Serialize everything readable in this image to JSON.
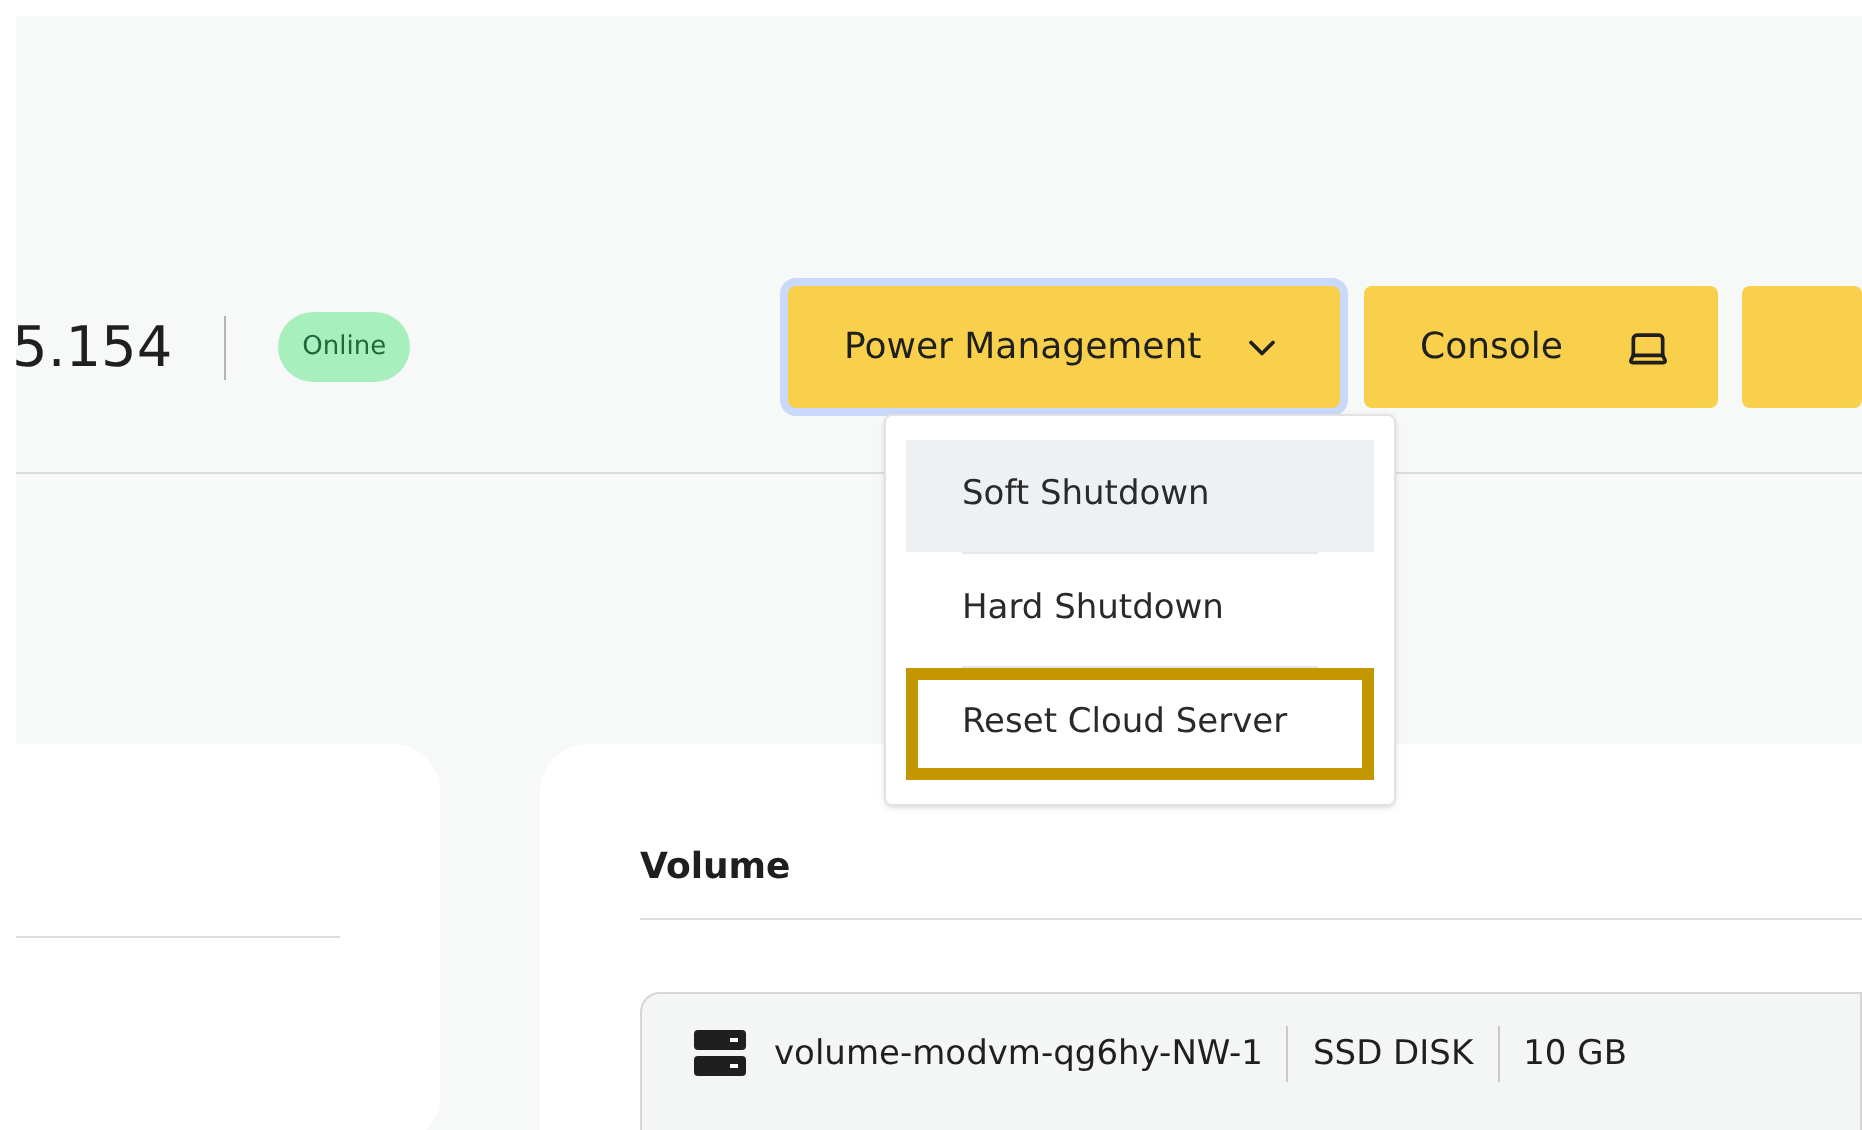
{
  "header": {
    "address": "5.154",
    "status": "Online",
    "buttons": [
      {
        "label": "Power Management",
        "kind": "dropdown",
        "focused": true
      },
      {
        "label": "Console",
        "kind": "console",
        "focused": false
      },
      {
        "kind": "cut",
        "focused": false
      }
    ]
  },
  "power_menu": {
    "items": [
      {
        "label": "Soft Shutdown",
        "selected": true,
        "highlighted": false
      },
      {
        "label": "Hard Shutdown",
        "selected": false,
        "highlighted": false
      },
      {
        "label": "Reset Cloud Server",
        "selected": false,
        "highlighted": true
      }
    ]
  },
  "volume_card": {
    "title": "Volume",
    "volume": {
      "name": "volume-modvm-qg6hy-NW-1",
      "type": "SSD DISK",
      "size": "10 GB"
    }
  }
}
